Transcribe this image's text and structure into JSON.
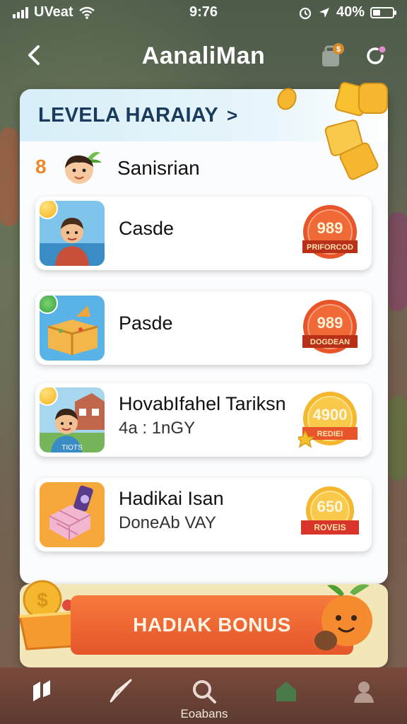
{
  "status": {
    "carrier": "UVeat",
    "time": "9:76",
    "battery": "40%",
    "battery_level": 0.4
  },
  "header": {
    "title": "AanaliMan"
  },
  "panel": {
    "heading": "LEVELA HARAIAY",
    "user": {
      "rank": "8",
      "name": "Sanisrian"
    },
    "items": [
      {
        "title": "Casde",
        "subtitle": "",
        "badge_value": "989",
        "badge_label": "PRIFORCOD"
      },
      {
        "title": "Pasde",
        "subtitle": "",
        "badge_value": "989",
        "badge_label": "DOGDEAN"
      },
      {
        "title": "HovabIfahel Tariksn",
        "subtitle": "4a : 1nGY",
        "badge_value": "4900",
        "badge_label": "REDIEI",
        "thumb_caption": "TIOTS"
      },
      {
        "title": "Hadikai Isan",
        "subtitle": "DoneAb VAY",
        "badge_value": "650",
        "badge_label": "ROVEIS"
      }
    ]
  },
  "bonus": {
    "label": "HADIAK BONUS"
  },
  "tabbar": {
    "tabs": [
      {
        "label": ""
      },
      {
        "label": ""
      },
      {
        "label": "Eoabans"
      },
      {
        "label": ""
      },
      {
        "label": ""
      }
    ]
  },
  "colors": {
    "badge_red": "#e9552b",
    "badge_gold": "#f5b72e",
    "bonus_orange": "#ec6330",
    "heading": "#1b3b5c"
  }
}
